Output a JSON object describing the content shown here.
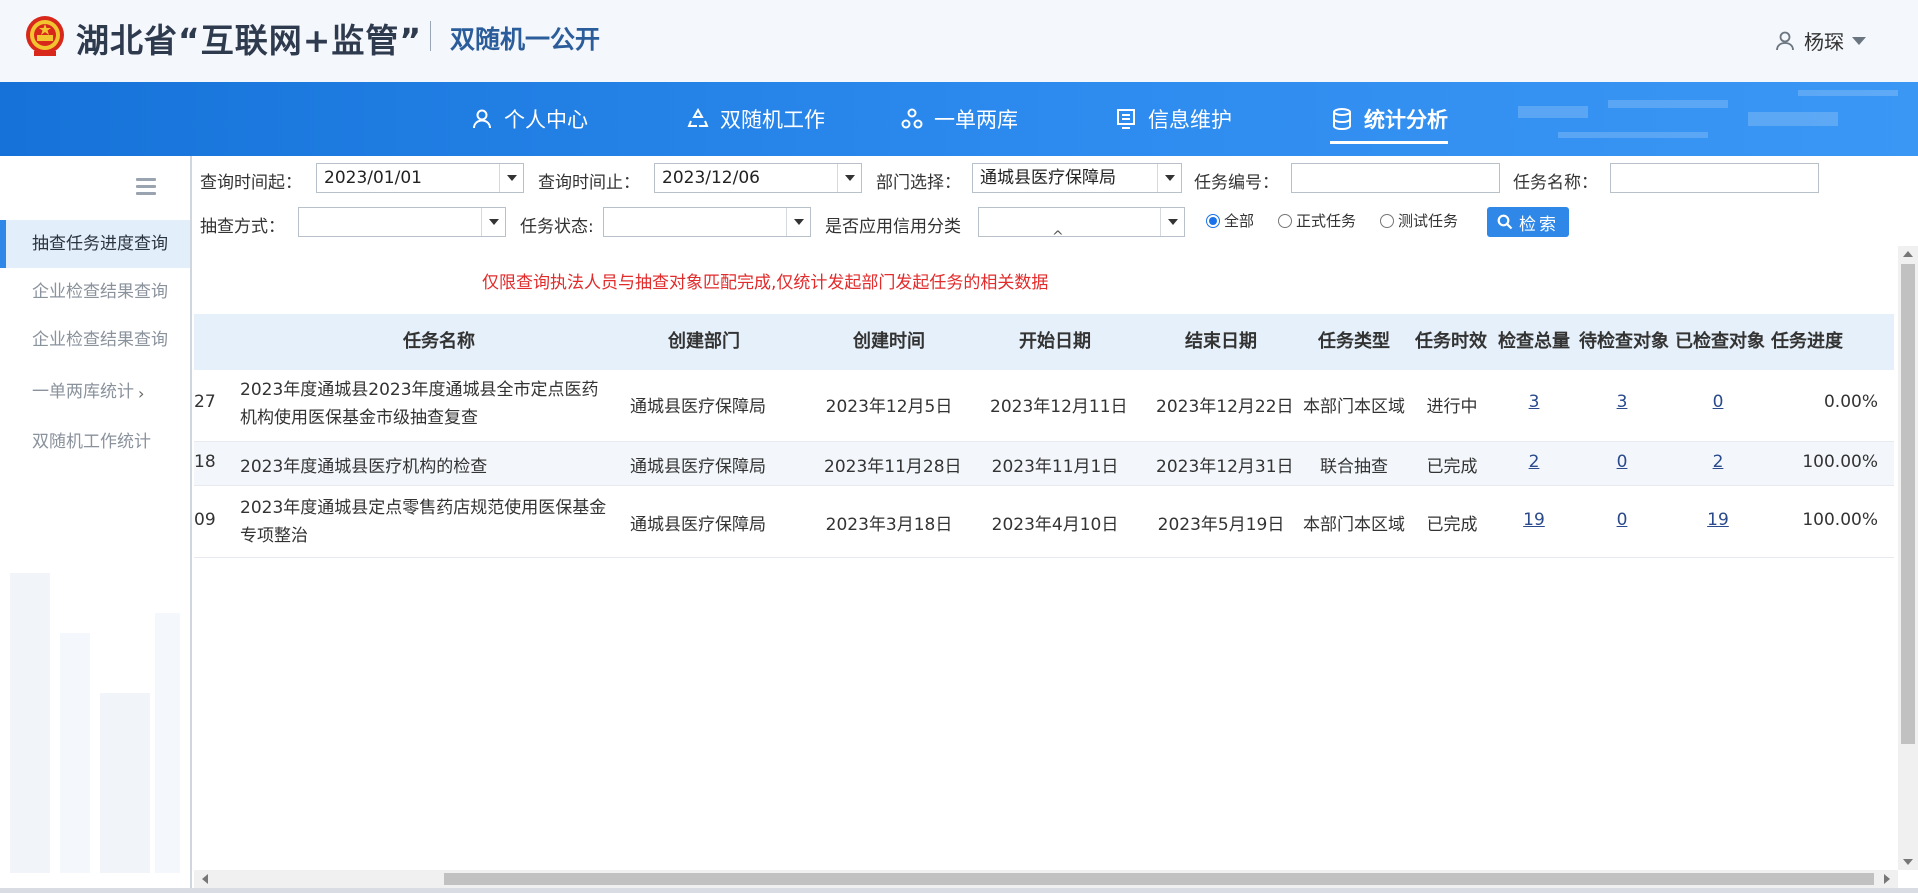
{
  "header": {
    "brand_title": "湖北省“互联网+监管”",
    "brand_sub": "双随机一公开",
    "user_name": "杨琛"
  },
  "nav": {
    "items": [
      {
        "label": "个人中心",
        "icon": "user-icon"
      },
      {
        "label": "双随机工作",
        "icon": "recycle-icon"
      },
      {
        "label": "一单两库",
        "icon": "nodes-icon"
      },
      {
        "label": "信息维护",
        "icon": "document-icon"
      },
      {
        "label": "统计分析",
        "icon": "database-icon",
        "active": true
      }
    ]
  },
  "sidebar": {
    "items": [
      {
        "label": "抽查任务进度查询",
        "active": true
      },
      {
        "label": "企业检查结果查询"
      },
      {
        "label": "企业检查结果查询"
      },
      {
        "label": "一单两库统计"
      },
      {
        "label": "双随机工作统计"
      }
    ]
  },
  "filters": {
    "start_label": "查询时间起：",
    "start_value": "2023/01/01",
    "end_label": "查询时间止：",
    "end_value": "2023/12/06",
    "dept_label": "部门选择：",
    "dept_value": "通城县医疗保障局",
    "task_no_label": "任务编号：",
    "task_no_value": "",
    "task_name_label": "任务名称：",
    "task_name_value": "",
    "method_label": "抽查方式：",
    "method_value": "",
    "status_label": "任务状态:",
    "status_value": "",
    "credit_label": "是否应用信用分类",
    "credit_value": "",
    "radios": [
      "全部",
      "正式任务",
      "测试任务"
    ],
    "search_label": "检索"
  },
  "notice": "仅限查询执法人员与抽查对象匹配完成,仅统计发起部门发起任务的相关数据",
  "table": {
    "headers": [
      "任务名称",
      "创建部门",
      "创建时间",
      "开始日期",
      "结束日期",
      "任务类型",
      "任务时效",
      "检查总量",
      "待检查对象",
      "已检查对象",
      "任务进度"
    ],
    "rows": [
      {
        "id_tail": "27",
        "name": "2023年度通城县2023年度通城县全市定点医药机构使用医保基金市级抽查复查",
        "dept": "通城县医疗保障局",
        "created": "2023年12月5日",
        "start": "2023年12月11日",
        "end": "2023年12月22日",
        "type": "本部门本区域",
        "timeliness": "进行中",
        "total": "3",
        "pending": "3",
        "checked": "0",
        "progress": "0.00%"
      },
      {
        "id_tail": "18",
        "name": "2023年度通城县医疗机构的检查",
        "dept": "通城县医疗保障局",
        "created": "2023年11月28日",
        "start": "2023年11月1日",
        "end": "2023年12月31日",
        "type": "联合抽查",
        "timeliness": "已完成",
        "total": "2",
        "pending": "0",
        "checked": "2",
        "progress": "100.00%"
      },
      {
        "id_tail": "09",
        "name": "2023年度通城县定点零售药店规范使用医保基金专项整治",
        "dept": "通城县医疗保障局",
        "created": "2023年3月18日",
        "start": "2023年4月10日",
        "end": "2023年5月19日",
        "type": "本部门本区域",
        "timeliness": "已完成",
        "total": "19",
        "pending": "0",
        "checked": "19",
        "progress": "100.00%"
      }
    ]
  },
  "colors": {
    "nav_blue": "#2d8bef",
    "accent": "#2f87e8",
    "notice_red": "#e22b2b",
    "header_bg": "#f4f7fb"
  }
}
